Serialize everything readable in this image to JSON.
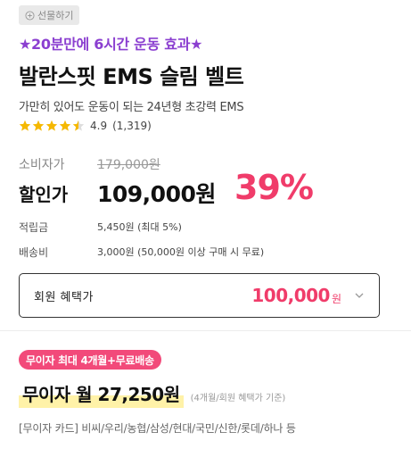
{
  "gift": {
    "label": "선물하기"
  },
  "promo": {
    "text": "★20분만에 6시간 운동 효과★"
  },
  "product": {
    "title": "발란스핏 EMS 슬림 벨트",
    "subtitle": "가만히 있어도 운동이 되는 24년형 초강력 EMS",
    "rating": "4.9",
    "review_count": "(1,319)",
    "stars": [
      1,
      1,
      1,
      1,
      0.5
    ]
  },
  "pricing": {
    "list_label": "소비자가",
    "list_price": "179,000원",
    "sale_label": "할인가",
    "sale_price": "109,000원",
    "discount": "39%",
    "points_label": "적립금",
    "points_value": "5,450원 (최대 5%)",
    "shipping_label": "배송비",
    "shipping_value": "3,000원 (50,000원 이상 구매 시 무료)"
  },
  "member": {
    "label": "회원 혜택가",
    "price": "100,000",
    "unit": "원"
  },
  "installment": {
    "badge": "무이자 최대 4개월+무료배송",
    "amount": "무이자 월 27,250원",
    "note": "(4개월/회원 혜택가 기준)",
    "cards": "[무이자 카드] 비씨/우리/농협/삼성/현대/국민/신한/롯데/하나 등"
  },
  "colors": {
    "accent_pink": "#f03c6a",
    "promo_purple": "#8b3fd0",
    "star_yellow": "#f5b800",
    "highlight_yellow": "#fff2a8"
  },
  "icons": {
    "gift": "gift-icon",
    "star": "star-icon",
    "chevron": "chevron-down-icon"
  }
}
